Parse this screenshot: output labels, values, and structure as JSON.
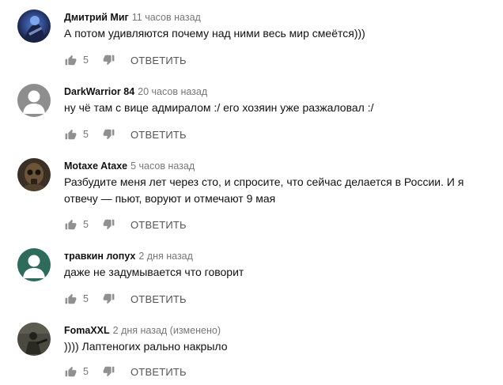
{
  "comments": [
    {
      "author": "Дмитрий Миг",
      "time": "11 часов назад",
      "text": "А потом удивляются почему над ними весь мир смеётся)))",
      "likes": "5",
      "reply_label": "ОТВЕТИТЬ",
      "avatar": "photo-blue-figure"
    },
    {
      "author": "DarkWarrior 84",
      "time": "20 часов назад",
      "text": "ну чё там с вице адмиралом :/ его хозяин уже разжаловал :/",
      "likes": "5",
      "reply_label": "ОТВЕТИТЬ",
      "avatar": "default-gray"
    },
    {
      "author": "Motaxe Ataxe",
      "time": "5 часов назад",
      "text": "Разбудите меня лет через сто, и спросите, что сейчас делается в России. И я отвечу — пьют, воруют и отмечают 9 мая",
      "likes": "5",
      "reply_label": "ОТВЕТИТЬ",
      "avatar": "photo-gasmask"
    },
    {
      "author": "травкин лопух",
      "time": "2 дня назад",
      "text": "даже не задумывается что говорит",
      "likes": "5",
      "reply_label": "ОТВЕТИТЬ",
      "avatar": "default-teal"
    },
    {
      "author": "FomaXXL",
      "time": "2 дня назад (изменено)",
      "text": ")))) Лаптеногих рально накрыло",
      "likes": "5",
      "reply_label": "ОТВЕТИТЬ",
      "avatar": "photo-soldier"
    }
  ],
  "colors": {
    "icon": "#909090",
    "meta_text": "#777777",
    "avatar_gray": "#8e8e8e",
    "avatar_teal": "#2e6b5a"
  }
}
